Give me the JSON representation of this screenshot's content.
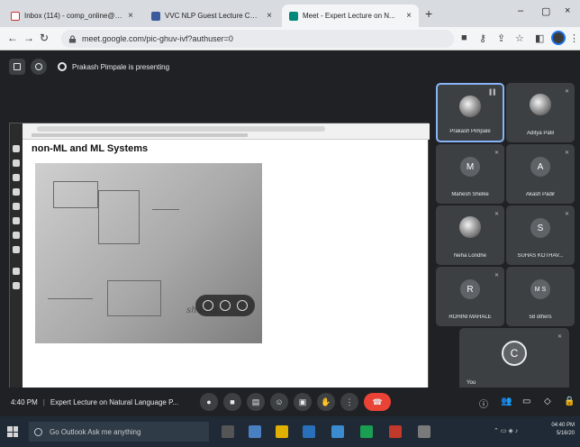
{
  "browser": {
    "tabs": [
      {
        "title": "Inbox (114) - comp_online@em...",
        "close": "×"
      },
      {
        "title": "VVC NLP Guest Lecture COMP-...",
        "close": "×"
      },
      {
        "title": "Meet - Expert Lecture on N...",
        "close": "×"
      }
    ],
    "new_tab": "+",
    "window_controls": {
      "minimize": "–",
      "maximize": "▢",
      "close": "×"
    },
    "address": "meet.google.com/pic-ghuv-ivf?authuser=0",
    "nav": {
      "back": "←",
      "forward": "→",
      "reload": "↻",
      "home": "⌂"
    }
  },
  "meet": {
    "presenting_text": "Prakash Pimpale is presenting",
    "slide_title": "non-ML and ML Systems",
    "handwriting": "shakes",
    "participants": [
      {
        "name": "Prakash Pimpale",
        "initial": "",
        "photo": true,
        "speaking": true
      },
      {
        "name": "Aditya Patil",
        "initial": "",
        "photo": true,
        "speaking": false
      },
      {
        "name": "Mahesh Shelke",
        "initial": "M",
        "photo": false,
        "speaking": false
      },
      {
        "name": "Akash Padir",
        "initial": "A",
        "photo": false,
        "speaking": false
      },
      {
        "name": "Neha Londhe",
        "initial": "",
        "photo": true,
        "speaking": false
      },
      {
        "name": "SUHAS KOTHAV...",
        "initial": "S",
        "photo": false,
        "speaking": false
      },
      {
        "name": "ROHINI MAHALE",
        "initial": "R",
        "photo": false,
        "speaking": false
      },
      {
        "name": "58 others",
        "initial": "M S",
        "photo": false,
        "speaking": false
      }
    ],
    "you": {
      "name": "You",
      "initial": "C"
    },
    "time": "4:40 PM",
    "meeting_title": "Expert Lecture on Natural Language P..."
  },
  "taskbar": {
    "search_placeholder": "Go Outlook Ask me anything",
    "clock_time": "04:40 PM",
    "clock_date": "5/16/20"
  },
  "colors": {
    "meet_bg": "#202124",
    "tile_bg": "#3c4043",
    "end_call": "#ea4335",
    "speaking_border": "#8ab4f8"
  }
}
